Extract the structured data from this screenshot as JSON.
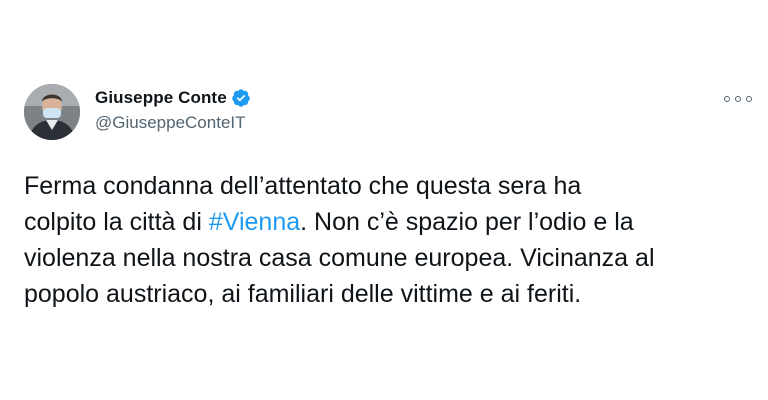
{
  "author": {
    "display_name": "Giuseppe Conte",
    "handle": "@GiuseppeConteIT",
    "verified": true,
    "verified_color": "#1d9bf0"
  },
  "menu": {
    "icon": "more-horizontal-icon"
  },
  "tweet": {
    "text_before": "Ferma condanna dell’attentato che questa sera ha\ncolpito la città di ",
    "hashtag": "#Vienna",
    "text_after": ". Non c’è spazio per l’odio e la\nviolenza nella nostra casa comune europea. Vicinanza al\npopolo austriaco, ai familiari delle vittime e ai feriti."
  },
  "colors": {
    "text": "#0f1419",
    "secondary": "#536471",
    "link": "#1d9bf0",
    "background": "#ffffff"
  }
}
